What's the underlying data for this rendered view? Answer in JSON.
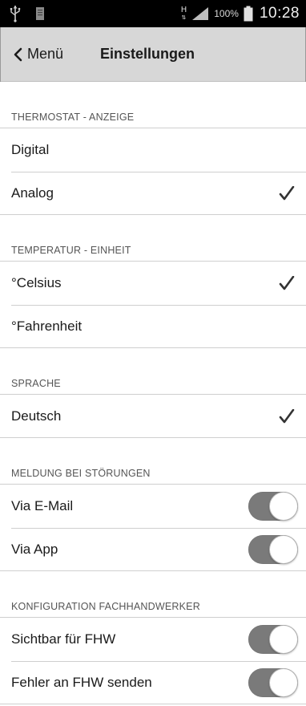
{
  "status_bar": {
    "usb_icon": "usb-icon",
    "doc_icon": "document-icon",
    "network_type": "H",
    "battery_percent": "100%",
    "time": "10:28"
  },
  "header": {
    "back_label": "Menü",
    "title": "Einstellungen"
  },
  "sections": {
    "thermostat": {
      "header": "THERMOSTAT - ANZEIGE",
      "items": [
        {
          "label": "Digital",
          "checked": false
        },
        {
          "label": "Analog",
          "checked": true
        }
      ]
    },
    "temperature": {
      "header": "TEMPERATUR - EINHEIT",
      "items": [
        {
          "label": "°Celsius",
          "checked": true
        },
        {
          "label": "°Fahrenheit",
          "checked": false
        }
      ]
    },
    "language": {
      "header": "SPRACHE",
      "items": [
        {
          "label": "Deutsch",
          "checked": true
        }
      ]
    },
    "alerts": {
      "header": "MELDUNG BEI STÖRUNGEN",
      "items": [
        {
          "label": "Via E-Mail",
          "toggle": "off"
        },
        {
          "label": "Via App",
          "toggle": "off"
        }
      ]
    },
    "installer": {
      "header": "KONFIGURATION FACHHANDWERKER",
      "items": [
        {
          "label": "Sichtbar für FHW",
          "toggle": "off"
        },
        {
          "label": "Fehler an FHW senden",
          "toggle": "off"
        }
      ]
    }
  },
  "colors": {
    "status_bar_bg": "#000000",
    "title_bar_bg": "#d7d7d7",
    "toggle_track": "#7a7a7a"
  }
}
